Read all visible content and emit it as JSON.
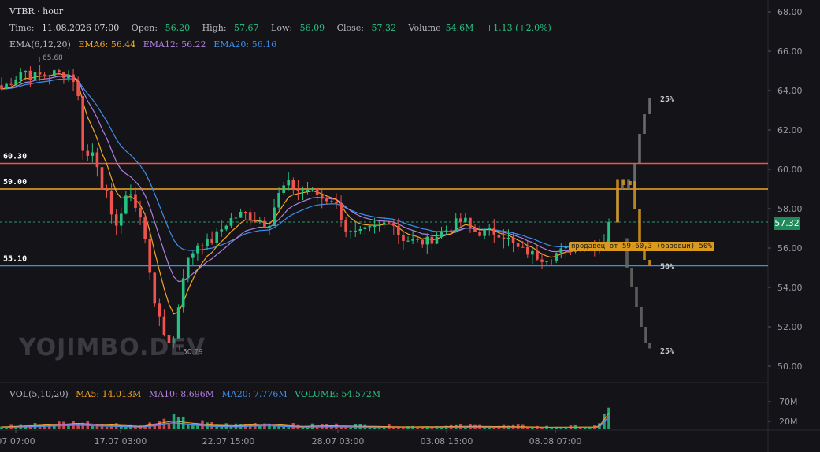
{
  "header": {
    "title": "VTBR · hour",
    "time_label": "Time:",
    "time_value": "11.08.2026 07:00",
    "open_label": "Open:",
    "open_value": "56,20",
    "high_label": "High:",
    "high_value": "57,67",
    "low_label": "Low:",
    "low_value": "56,09",
    "close_label": "Close:",
    "close_value": "57,32",
    "volume_label": "Volume",
    "volume_value": "54.6M",
    "change": "+1,13 (+2.0%)"
  },
  "ema_legend": {
    "title": "EMA(6,12,20)",
    "ema6": "EMA6: 56.44",
    "ema12": "EMA12: 56.22",
    "ema20": "EMA20: 56.16"
  },
  "vol_legend": {
    "title": "VOL(5,10,20)",
    "ma5": "MA5: 14.013M",
    "ma10": "MA10: 8.696M",
    "ma20": "MA20: 7.776M",
    "volume": "VOLUME: 54.572M"
  },
  "watermark": "YOJIMBO.DEV",
  "current_price": "57.32",
  "annotation": "продавец от 59-60,3 (базовый) 50%",
  "colors": {
    "up": "#26c281",
    "down": "#ef5350",
    "ema6": "#f5a623",
    "ema12": "#b07fdc",
    "ema20": "#3d8ee8",
    "level_red": "#ef5350",
    "level_orange": "#f5a623",
    "level_blue": "#3d8ee8"
  },
  "chart_data": {
    "type": "candlestick",
    "ylim": [
      49.5,
      68.5
    ],
    "y_ticks": [
      "68.00",
      "66.00",
      "64.00",
      "62.00",
      "60.00",
      "58.00",
      "56.00",
      "54.00",
      "52.00",
      "50.00"
    ],
    "x_ticks": [
      "07 07:00",
      "17.07 03:00",
      "22.07 15:00",
      "28.07 03:00",
      "03.08 15:00",
      "08.08 07:00"
    ],
    "vol_ticks": [
      "70M",
      "20M"
    ],
    "levels": [
      {
        "label": "60.30",
        "value": 60.3,
        "color": "#ef5350"
      },
      {
        "label": "59.00",
        "value": 59.0,
        "color": "#f5a623"
      },
      {
        "label": "55.10",
        "value": 55.1,
        "color": "#3d8ee8"
      }
    ],
    "current_price": 57.32,
    "high_marker": {
      "label": "65.68",
      "value": 65.68
    },
    "low_marker": {
      "label": "50.79",
      "value": 50.79
    },
    "scenario_labels": [
      {
        "label": "25%",
        "value": 63.6
      },
      {
        "label": "50%",
        "value": 55.1
      },
      {
        "label": "25%",
        "value": 50.8
      }
    ],
    "price_anchors": [
      [
        0,
        64.0
      ],
      [
        8,
        64.3
      ],
      [
        18,
        64.6
      ],
      [
        30,
        65.1
      ],
      [
        40,
        64.7
      ],
      [
        55,
        64.8
      ],
      [
        70,
        64.9
      ],
      [
        90,
        64.8
      ],
      [
        98,
        64.2
      ],
      [
        104,
        61.2
      ],
      [
        112,
        60.6
      ],
      [
        120,
        61.0
      ],
      [
        128,
        59.3
      ],
      [
        135,
        58.8
      ],
      [
        142,
        57.4
      ],
      [
        150,
        57.3
      ],
      [
        158,
        58.3
      ],
      [
        166,
        58.9
      ],
      [
        174,
        57.8
      ],
      [
        180,
        57.4
      ],
      [
        188,
        55.4
      ],
      [
        196,
        53.4
      ],
      [
        204,
        52.0
      ],
      [
        212,
        51.3
      ],
      [
        222,
        51.4
      ],
      [
        230,
        54.3
      ],
      [
        238,
        55.3
      ],
      [
        246,
        55.9
      ],
      [
        254,
        56.4
      ],
      [
        262,
        56.2
      ],
      [
        270,
        56.4
      ],
      [
        280,
        56.9
      ],
      [
        290,
        57.4
      ],
      [
        300,
        57.6
      ],
      [
        310,
        57.8
      ],
      [
        320,
        57.5
      ],
      [
        330,
        57.4
      ],
      [
        340,
        57.1
      ],
      [
        348,
        58.1
      ],
      [
        356,
        58.9
      ],
      [
        364,
        59.3
      ],
      [
        372,
        59.1
      ],
      [
        380,
        58.9
      ],
      [
        390,
        59.0
      ],
      [
        400,
        58.8
      ],
      [
        410,
        58.5
      ],
      [
        420,
        58.5
      ],
      [
        430,
        58.0
      ],
      [
        438,
        57.0
      ],
      [
        446,
        56.7
      ],
      [
        456,
        56.7
      ],
      [
        466,
        56.9
      ],
      [
        476,
        57.0
      ],
      [
        486,
        57.2
      ],
      [
        496,
        57.6
      ],
      [
        504,
        56.8
      ],
      [
        512,
        56.5
      ],
      [
        520,
        56.4
      ],
      [
        530,
        56.3
      ],
      [
        540,
        56.3
      ],
      [
        550,
        56.5
      ],
      [
        560,
        56.8
      ],
      [
        570,
        57.0
      ],
      [
        580,
        57.3
      ],
      [
        590,
        57.4
      ],
      [
        598,
        56.9
      ],
      [
        606,
        56.8
      ],
      [
        614,
        56.8
      ],
      [
        622,
        56.8
      ],
      [
        632,
        56.8
      ],
      [
        642,
        56.6
      ],
      [
        650,
        56.2
      ],
      [
        660,
        55.9
      ],
      [
        670,
        55.8
      ],
      [
        680,
        55.6
      ],
      [
        690,
        55.5
      ],
      [
        700,
        55.6
      ],
      [
        710,
        55.8
      ],
      [
        720,
        55.9
      ],
      [
        730,
        56.1
      ],
      [
        742,
        56.3
      ],
      [
        755,
        56.2
      ],
      [
        767,
        56.4
      ],
      [
        773,
        57.3
      ]
    ],
    "volume_anchors": [
      [
        0,
        8
      ],
      [
        40,
        12
      ],
      [
        100,
        20
      ],
      [
        130,
        16
      ],
      [
        180,
        10
      ],
      [
        220,
        28
      ],
      [
        240,
        22
      ],
      [
        270,
        14
      ],
      [
        300,
        12
      ],
      [
        340,
        18
      ],
      [
        380,
        10
      ],
      [
        420,
        12
      ],
      [
        470,
        10
      ],
      [
        520,
        8
      ],
      [
        560,
        9
      ],
      [
        600,
        10
      ],
      [
        650,
        9
      ],
      [
        700,
        7
      ],
      [
        760,
        8
      ],
      [
        773,
        54.6
      ]
    ]
  }
}
